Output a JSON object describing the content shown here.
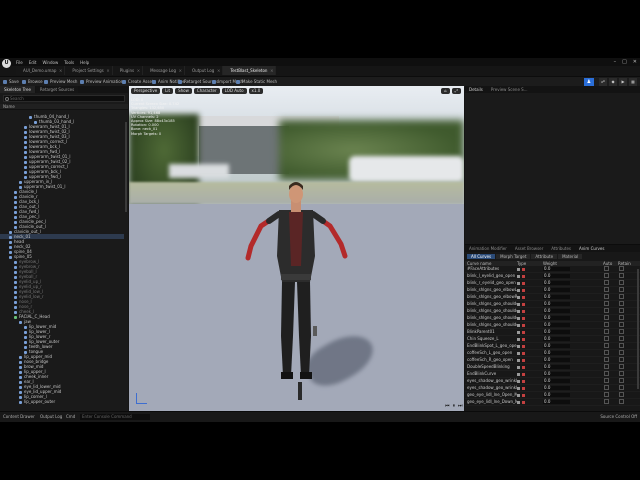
{
  "menu": {
    "items": [
      "File",
      "Edit",
      "Window",
      "Tools",
      "Help"
    ],
    "logo": "U"
  },
  "tabs": [
    {
      "label": "AUI_Demo.umap",
      "active": false
    },
    {
      "label": "Project Settings",
      "active": false
    },
    {
      "label": "Plugins",
      "active": false
    },
    {
      "label": "Message Log",
      "active": false
    },
    {
      "label": "Output Log",
      "active": false
    },
    {
      "label": "TestBlast_Skeleton",
      "active": true
    }
  ],
  "toolbar": {
    "items": [
      "Save",
      "Browse",
      "Preview Mesh",
      "Preview Animation",
      "Create Asset",
      "Anim Notifies",
      "Retarget Sources",
      "Import Mesh",
      "Make Static Mesh"
    ],
    "profile_icon": "person-icon"
  },
  "left_panel": {
    "tabs": [
      "Skeleton Tree",
      "Retarget Sources"
    ],
    "search_placeholder": "Search",
    "name_header": "Name",
    "rows": [
      {
        "label": "thumb_04_hand_l",
        "indent": 5,
        "kind": "bone"
      },
      {
        "label": "thumb_03_hand_l",
        "indent": 6,
        "kind": "bone"
      },
      {
        "label": "lowerarm_twist_01_l",
        "indent": 4,
        "kind": "bone"
      },
      {
        "label": "lowerarm_twist_02_l",
        "indent": 4,
        "kind": "bone"
      },
      {
        "label": "lowerarm_twist_03_l",
        "indent": 4,
        "kind": "bone"
      },
      {
        "label": "lowerarm_correct_l",
        "indent": 4,
        "kind": "bone"
      },
      {
        "label": "lowerarm_bck_l",
        "indent": 4,
        "kind": "bone"
      },
      {
        "label": "lowerarm_fwd_l",
        "indent": 4,
        "kind": "bone"
      },
      {
        "label": "upperarm_twist_01_l",
        "indent": 4,
        "kind": "bone"
      },
      {
        "label": "upperarm_twist_02_l",
        "indent": 4,
        "kind": "bone"
      },
      {
        "label": "upperarm_correct_l",
        "indent": 4,
        "kind": "bone"
      },
      {
        "label": "upperarm_bck_l",
        "indent": 4,
        "kind": "bone"
      },
      {
        "label": "upperarm_fwd_l",
        "indent": 4,
        "kind": "bone"
      },
      {
        "label": "upperarm_in_l",
        "indent": 3,
        "kind": "bone"
      },
      {
        "label": "upperarm_twist_01_l",
        "indent": 3,
        "kind": "bone"
      },
      {
        "label": "clavicle_l",
        "indent": 2,
        "kind": "bone"
      },
      {
        "label": "clavicle_r",
        "indent": 2,
        "kind": "bone"
      },
      {
        "label": "clav_bck_l",
        "indent": 2,
        "kind": "bone"
      },
      {
        "label": "clav_out_l",
        "indent": 2,
        "kind": "bone"
      },
      {
        "label": "clav_fwd_l",
        "indent": 2,
        "kind": "bone"
      },
      {
        "label": "clav_pec_l",
        "indent": 2,
        "kind": "bone"
      },
      {
        "label": "clavicle_pec_l",
        "indent": 2,
        "kind": "bone"
      },
      {
        "label": "clavicle_out_l",
        "indent": 2,
        "kind": "bone"
      },
      {
        "label": "clavicle_out_l",
        "indent": 1,
        "kind": "bone"
      },
      {
        "label": "neck_01",
        "indent": 1,
        "kind": "bone",
        "selected": true
      },
      {
        "label": "head",
        "indent": 1,
        "kind": "bone"
      },
      {
        "label": "neck_02",
        "indent": 1,
        "kind": "bone"
      },
      {
        "label": "spine_04",
        "indent": 1,
        "kind": "bone"
      },
      {
        "label": "spine_05",
        "indent": 1,
        "kind": "bone"
      },
      {
        "label": "eyebrow_l",
        "indent": 2,
        "kind": "bone",
        "dim": true
      },
      {
        "label": "eyebrow_r",
        "indent": 2,
        "kind": "bone",
        "dim": true
      },
      {
        "label": "eyeball_l",
        "indent": 2,
        "kind": "bone",
        "dim": true
      },
      {
        "label": "eyeball_r",
        "indent": 2,
        "kind": "bone",
        "dim": true
      },
      {
        "label": "eyelid_up_l",
        "indent": 2,
        "kind": "bone",
        "dim": true
      },
      {
        "label": "eyelid_up_r",
        "indent": 2,
        "kind": "bone",
        "dim": true
      },
      {
        "label": "eyelid_low_l",
        "indent": 2,
        "kind": "bone",
        "dim": true
      },
      {
        "label": "eyelid_low_r",
        "indent": 2,
        "kind": "bone",
        "dim": true
      },
      {
        "label": "nose_l",
        "indent": 2,
        "kind": "bone",
        "dim": true
      },
      {
        "label": "nose_r",
        "indent": 2,
        "kind": "bone",
        "dim": true
      },
      {
        "label": "cheek_l",
        "indent": 2,
        "kind": "bone",
        "dim": true
      },
      {
        "label": "FACIAL_C_Head",
        "indent": 2,
        "kind": "socket"
      },
      {
        "label": "jaw",
        "indent": 3,
        "kind": "bone"
      },
      {
        "label": "lip_lower_mid",
        "indent": 4,
        "kind": "bone"
      },
      {
        "label": "lip_lower_l",
        "indent": 4,
        "kind": "bone"
      },
      {
        "label": "lip_lower_r",
        "indent": 4,
        "kind": "bone"
      },
      {
        "label": "lip_lower_outer",
        "indent": 4,
        "kind": "bone"
      },
      {
        "label": "teeth_lower",
        "indent": 4,
        "kind": "bone"
      },
      {
        "label": "tongue",
        "indent": 4,
        "kind": "bone"
      },
      {
        "label": "lip_upper_mid",
        "indent": 3,
        "kind": "bone"
      },
      {
        "label": "nose_bridge",
        "indent": 3,
        "kind": "bone"
      },
      {
        "label": "brow_mid",
        "indent": 3,
        "kind": "bone"
      },
      {
        "label": "lip_upper_l",
        "indent": 3,
        "kind": "bone"
      },
      {
        "label": "cheek_inner",
        "indent": 3,
        "kind": "bone"
      },
      {
        "label": "ear_l",
        "indent": 3,
        "kind": "bone"
      },
      {
        "label": "eye_lid_lower_mid",
        "indent": 3,
        "kind": "bone"
      },
      {
        "label": "eye_lid_upper_mid",
        "indent": 3,
        "kind": "bone"
      },
      {
        "label": "lip_corner_l",
        "indent": 3,
        "kind": "bone"
      },
      {
        "label": "lip_upper_outer",
        "indent": 3,
        "kind": "bone"
      }
    ]
  },
  "viewport": {
    "toolbar_left": [
      "Perspective",
      "Lit",
      "Show",
      "Character",
      "LOD Auto",
      "x1.0"
    ],
    "stats": [
      "LOD: 0",
      "Current Screen Size: 0.742",
      "Triangles: 132,650",
      "Vertices: 91,468",
      "UV Channels: 2",
      "Approx Size: 88x43x185",
      "Rotation: 0.000",
      "Bone: neck_01",
      "Morph Targets: 0"
    ]
  },
  "right_panel": {
    "top_tabs": [
      "Details",
      "Preview Scene S..."
    ],
    "bottom_tabs": [
      "Animation Modifier",
      "Asset Browser",
      "Attributes",
      "Anim Curves"
    ],
    "sub_tabs": [
      "All Curves",
      "Morph Target",
      "Attribute",
      "Material"
    ],
    "headers": [
      "Curve name",
      "Type",
      "Weight",
      "Auto",
      "Retain"
    ],
    "curves": [
      {
        "name": "#FaceAttributes",
        "weight": "0.0"
      },
      {
        "name": "blink_l_eyelid_geo_open",
        "weight": "0.0"
      },
      {
        "name": "blink_r_eyelid_geo_open",
        "weight": "0.0"
      },
      {
        "name": "blink_shlgns_geo_elbowL_bend_L",
        "weight": "0.0"
      },
      {
        "name": "blink_shlgns_geo_elbowR_bend_R",
        "weight": "0.0"
      },
      {
        "name": "blink_shlgns_geo_shoulderL_elev",
        "weight": "0.0"
      },
      {
        "name": "blink_shlgns_geo_shoulderR_elev",
        "weight": "0.0"
      },
      {
        "name": "blink_shlgns_geo_shoulderL_up_L",
        "weight": "0.0"
      },
      {
        "name": "blink_shlgns_geo_shoulderR_up_R",
        "weight": "0.0"
      },
      {
        "name": "BlinkParent01",
        "weight": "0.0"
      },
      {
        "name": "Chin Squeeze_L",
        "weight": "0.0"
      },
      {
        "name": "EndBlinkSpot_L_geo_open",
        "weight": "0.0"
      },
      {
        "name": "coffeeSch_L_geo_open",
        "weight": "0.0"
      },
      {
        "name": "coffeeSch_R_geo_open",
        "weight": "0.0"
      },
      {
        "name": "DoubleSpeedBlinking",
        "weight": "0.0"
      },
      {
        "name": "EndBlinkCurve",
        "weight": "0.0"
      },
      {
        "name": "eyes_shadow_geo_wrinkle",
        "weight": "0.0"
      },
      {
        "name": "eyes_shadow_geo_wrinkle1",
        "weight": "0.0"
      },
      {
        "name": "geo_eye_lidl_lne_Open_MORPH",
        "weight": "0.0"
      },
      {
        "name": "geo_eye_lidl_lne_Down_MORPH",
        "weight": "0.0"
      }
    ]
  },
  "bottom_bar": {
    "items": [
      "Content Drawer",
      "Output Log",
      "Cmd"
    ],
    "console_placeholder": "Enter Console Command",
    "source_control": "Source Control Off"
  }
}
